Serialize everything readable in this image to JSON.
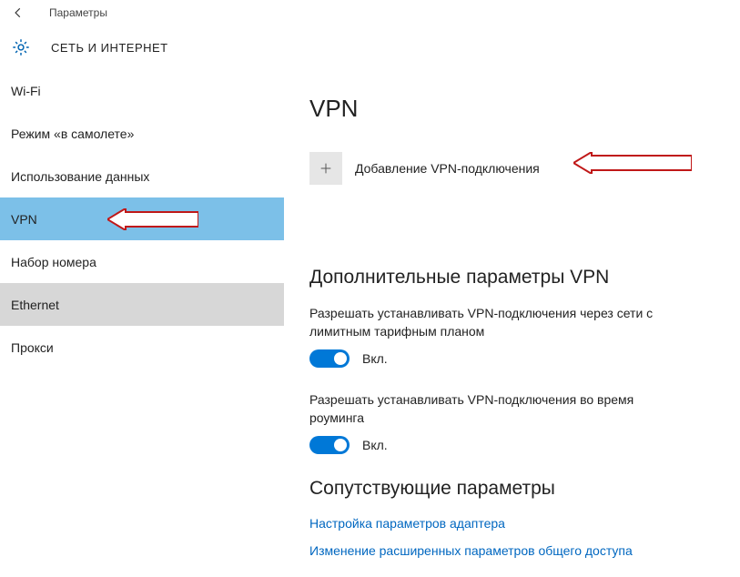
{
  "titlebar": {
    "title": "Параметры"
  },
  "header": {
    "title": "СЕТЬ И ИНТЕРНЕТ"
  },
  "sidebar": {
    "items": [
      {
        "label": "Wi-Fi"
      },
      {
        "label": "Режим «в самолете»"
      },
      {
        "label": "Использование данных"
      },
      {
        "label": "VPN"
      },
      {
        "label": "Набор номера"
      },
      {
        "label": "Ethernet"
      },
      {
        "label": "Прокси"
      }
    ]
  },
  "main": {
    "title": "VPN",
    "add_label": "Добавление VPN-подключения",
    "advanced_title": "Дополнительные параметры VPN",
    "toggle1_desc": "Разрешать устанавливать VPN-подключения через сети с лимитным тарифным планом",
    "toggle1_state": "Вкл.",
    "toggle2_desc": "Разрешать устанавливать VPN-подключения во время роуминга",
    "toggle2_state": "Вкл.",
    "related_title": "Сопутствующие параметры",
    "link1": "Настройка параметров адаптера",
    "link2": "Изменение расширенных параметров общего доступа"
  }
}
